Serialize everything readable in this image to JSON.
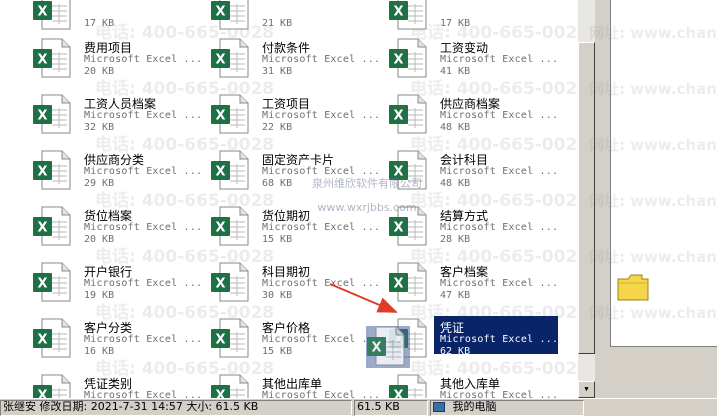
{
  "watermark": {
    "phone": "电话: 400-665-0028",
    "center_cn": "泉州维欣软件有限公司",
    "center_url": "www.wxrjbbs.com",
    "site": "网址: www.chanjet"
  },
  "files": [
    {
      "name": "",
      "type": "",
      "size": "17 KB"
    },
    {
      "name": "",
      "type": "",
      "size": "21 KB"
    },
    {
      "name": "",
      "type": "",
      "size": "17 KB"
    },
    {
      "name": "费用项目",
      "type": "Microsoft Excel ...",
      "size": "20 KB"
    },
    {
      "name": "付款条件",
      "type": "Microsoft Excel ...",
      "size": "31 KB"
    },
    {
      "name": "工资变动",
      "type": "Microsoft Excel ...",
      "size": "41 KB"
    },
    {
      "name": "工资人员档案",
      "type": "Microsoft Excel ...",
      "size": "32 KB"
    },
    {
      "name": "工资项目",
      "type": "Microsoft Excel ...",
      "size": "22 KB"
    },
    {
      "name": "供应商档案",
      "type": "Microsoft Excel ...",
      "size": "48 KB"
    },
    {
      "name": "供应商分类",
      "type": "Microsoft Excel ...",
      "size": "29 KB"
    },
    {
      "name": "固定资产卡片",
      "type": "Microsoft Excel ...",
      "size": "68 KB"
    },
    {
      "name": "会计科目",
      "type": "Microsoft Excel ...",
      "size": "48 KB"
    },
    {
      "name": "货位档案",
      "type": "Microsoft Excel ...",
      "size": "20 KB"
    },
    {
      "name": "货位期初",
      "type": "Microsoft Excel ...",
      "size": "15 KB"
    },
    {
      "name": "结算方式",
      "type": "Microsoft Excel ...",
      "size": "28 KB"
    },
    {
      "name": "开户银行",
      "type": "Microsoft Excel ...",
      "size": "19 KB"
    },
    {
      "name": "科目期初",
      "type": "Microsoft Excel ...",
      "size": "30 KB"
    },
    {
      "name": "客户档案",
      "type": "Microsoft Excel ...",
      "size": "47 KB"
    },
    {
      "name": "客户分类",
      "type": "Microsoft Excel ...",
      "size": "16 KB"
    },
    {
      "name": "客户价格",
      "type": "Microsoft Excel ...",
      "size": "15 KB"
    },
    {
      "name": "凭证",
      "type": "Microsoft Excel ...",
      "size": "62 KB",
      "selected": true
    },
    {
      "name": "凭证类别",
      "type": "Microsoft Excel ...",
      "size": ""
    },
    {
      "name": "其他出库单",
      "type": "Microsoft Excel ...",
      "size": ""
    },
    {
      "name": "其他入库单",
      "type": "Microsoft Excel ...",
      "size": ""
    }
  ],
  "status": {
    "details": "张继安 修改日期: 2021-7-31 14:57 大小: 61.5 KB",
    "size": "61.5 KB",
    "location": "我的电脑"
  },
  "colors": {
    "selection": "#0a246a",
    "excel_green": "#1e7145",
    "arrow": "#e03c2c",
    "folder": "#f5d64a"
  }
}
